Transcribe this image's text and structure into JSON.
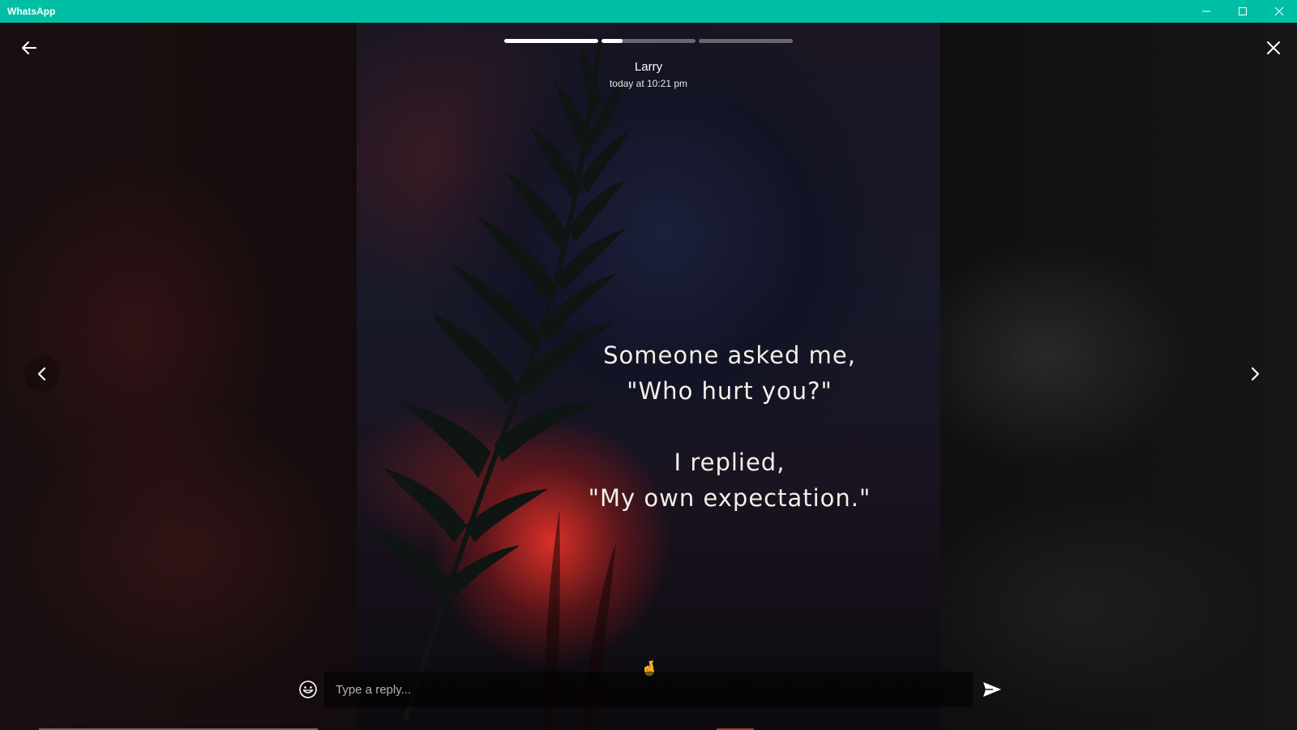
{
  "window": {
    "title": "WhatsApp",
    "controls": {
      "minimize": "minimize-icon",
      "maximize": "maximize-icon",
      "close": "close-icon"
    }
  },
  "status": {
    "author": "Larry",
    "timestamp": "today at 10:21 pm",
    "progress": [
      {
        "fraction": 1.0
      },
      {
        "fraction": 0.22
      },
      {
        "fraction": 0.0
      }
    ],
    "quote": {
      "line1": "Someone asked me,",
      "line2": "\"Who hurt you?\"",
      "line3": "I replied,",
      "line4": "\"My own expectation.\""
    },
    "emoji_reaction": "🤞"
  },
  "navigation": {
    "back_icon": "arrow-left-icon",
    "close_icon": "close-icon",
    "prev_icon": "chevron-left-icon",
    "next_icon": "chevron-right-icon"
  },
  "reply": {
    "placeholder": "Type a reply...",
    "value": "",
    "emoji_icon": "smiley-icon",
    "send_icon": "send-icon"
  },
  "colors": {
    "titlebar": "#00bfa5",
    "progress_filled": "#ffffff",
    "progress_empty": "rgba(255,255,255,0.35)"
  }
}
